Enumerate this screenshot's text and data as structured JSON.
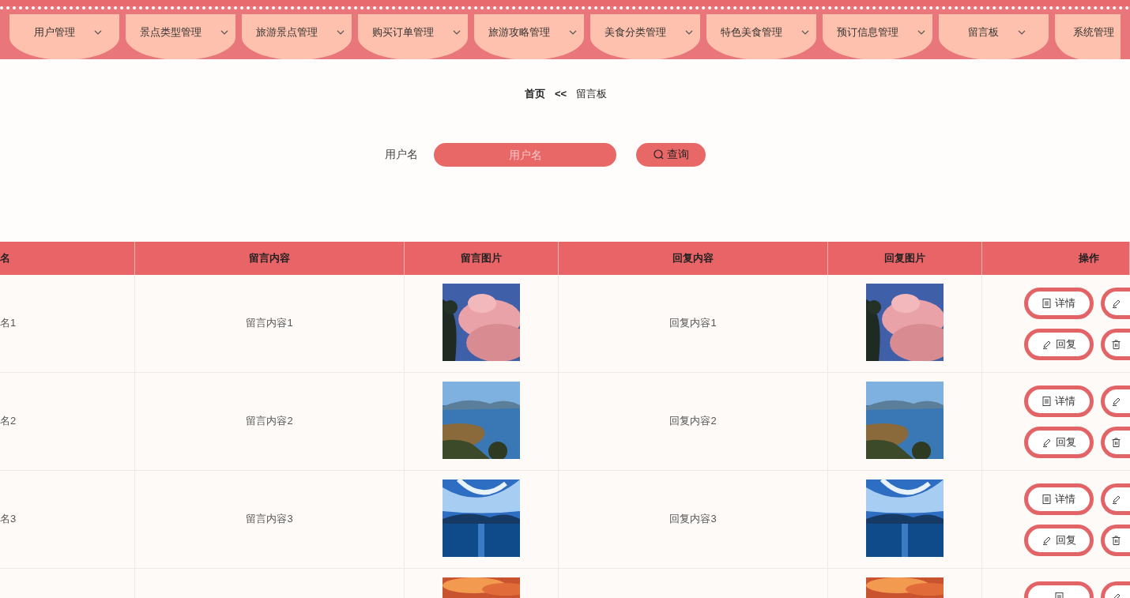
{
  "nav": [
    {
      "label": "用户管理",
      "dropdown": true
    },
    {
      "label": "景点类型管理",
      "dropdown": true
    },
    {
      "label": "旅游景点管理",
      "dropdown": true
    },
    {
      "label": "购买订单管理",
      "dropdown": true
    },
    {
      "label": "旅游攻略管理",
      "dropdown": true
    },
    {
      "label": "美食分类管理",
      "dropdown": true
    },
    {
      "label": "特色美食管理",
      "dropdown": true
    },
    {
      "label": "预订信息管理",
      "dropdown": true
    },
    {
      "label": "留言板",
      "dropdown": true
    },
    {
      "label": "系统管理",
      "dropdown": false
    }
  ],
  "breadcrumb": {
    "home": "首页",
    "separator": "<<",
    "current": "留言板"
  },
  "search": {
    "label": "用户名",
    "placeholder": "用户名",
    "button": "查询"
  },
  "table": {
    "columns": [
      "名",
      "留言内容",
      "留言图片",
      "回复内容",
      "回复图片",
      "操作"
    ],
    "rows": [
      {
        "user": "名1",
        "content": "留言内容1",
        "image": {
          "kind": "picture"
        },
        "reply": "回复内容1",
        "reply_image": {
          "kind": "picture"
        },
        "actions": [
          {
            "kind": "detail",
            "label": "详情"
          },
          {
            "kind": "edit"
          },
          {
            "kind": "reply",
            "label": "回复"
          },
          {
            "kind": "delete"
          }
        ]
      },
      {
        "user": "名2",
        "content": "留言内容2",
        "image": {
          "kind": "picture"
        },
        "reply": "回复内容2",
        "reply_image": {
          "kind": "picture"
        },
        "actions": [
          {
            "kind": "detail",
            "label": "详情"
          },
          {
            "kind": "edit"
          },
          {
            "kind": "reply",
            "label": "回复"
          },
          {
            "kind": "delete"
          }
        ]
      },
      {
        "user": "名3",
        "content": "留言内容3",
        "image": {
          "kind": "picture"
        },
        "reply": "回复内容3",
        "reply_image": {
          "kind": "picture"
        },
        "actions": [
          {
            "kind": "detail",
            "label": "详情"
          },
          {
            "kind": "edit"
          },
          {
            "kind": "reply",
            "label": "回复"
          },
          {
            "kind": "delete"
          }
        ]
      },
      {
        "image": {
          "kind": "picture"
        },
        "reply_image": {
          "kind": "picture"
        },
        "actions": [
          {
            "kind": "detail"
          },
          {
            "kind": "edit"
          }
        ]
      }
    ]
  }
}
